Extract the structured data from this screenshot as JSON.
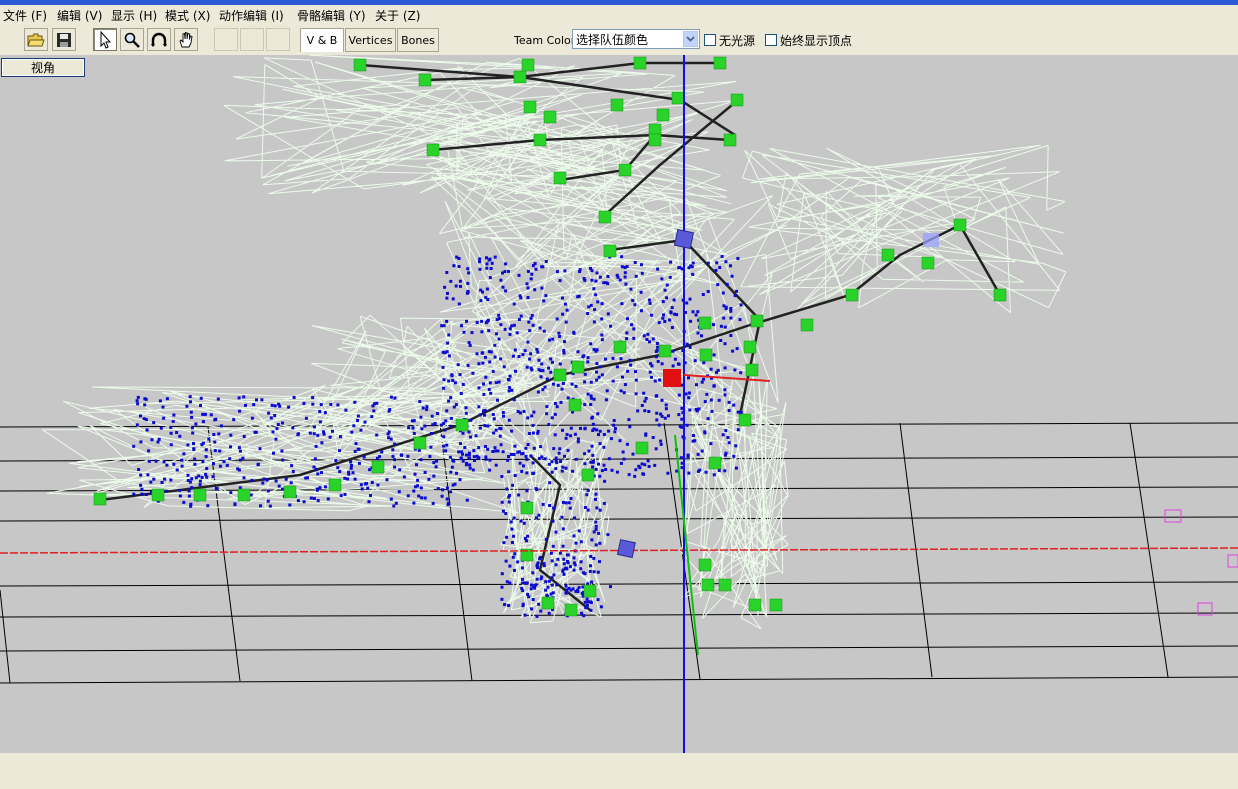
{
  "menu": {
    "file": "文件 (F)",
    "edit": "编辑 (V)",
    "display": "显示 (H)",
    "mode": "模式 (X)",
    "anim_edit": "动作编辑 (I)",
    "bone_edit": "骨骼编辑 (Y)",
    "about": "关于 (Z)"
  },
  "toolbar": {
    "icons": [
      "open-folder-icon",
      "save-disk-icon",
      "select-arrow-icon",
      "zoom-magnifier-icon",
      "rotate-icon",
      "pan-hand-icon"
    ],
    "tabs": {
      "vb": "V & B",
      "vertices": "Vertices",
      "bones": "Bones"
    },
    "team_color_label": "Team Color",
    "team_color_value": "选择队伍颜色",
    "no_light_label": "无光源",
    "no_light_checked": false,
    "always_show_vertices_label": "始终显示顶点",
    "always_show_vertices_checked": false
  },
  "view_button": "视角",
  "viewport": {
    "background_color": "#c7c7c7",
    "grid_color": "#000000",
    "x_axis_color": "#e02020",
    "y_axis_color": "#1010e0",
    "z_axis_color": "#10c010",
    "wireframe_color": "#ecfbea",
    "bone_color": "#29d329",
    "vertex_color": "#0a0ad0"
  }
}
